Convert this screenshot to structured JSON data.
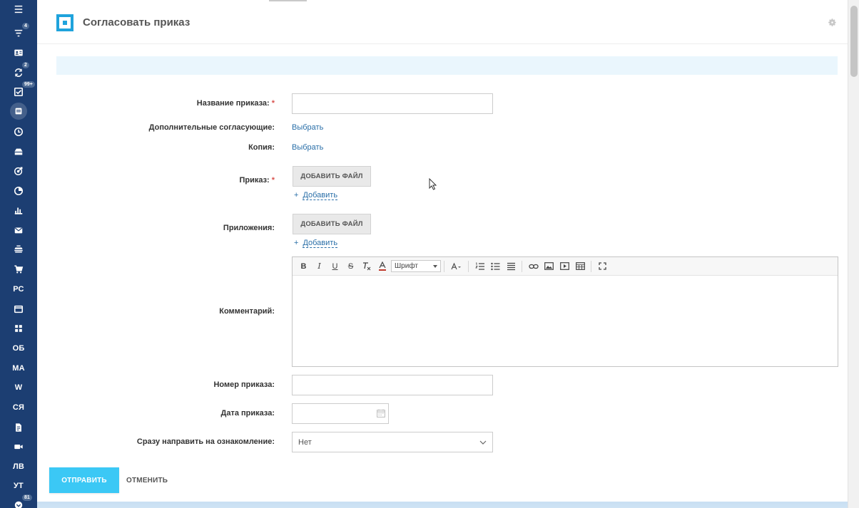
{
  "sidebar": {
    "items": [
      {
        "name": "menu-icon",
        "kind": "icon",
        "icon": "hamburger"
      },
      {
        "name": "filter-icon",
        "kind": "icon",
        "icon": "filter",
        "badge": "4"
      },
      {
        "name": "contact-card-icon",
        "kind": "icon",
        "icon": "card"
      },
      {
        "name": "sync-icon",
        "kind": "icon",
        "icon": "sync",
        "badge": "2"
      },
      {
        "name": "tasks-icon",
        "kind": "icon",
        "icon": "check",
        "badge": "99+"
      },
      {
        "name": "documents-icon",
        "kind": "icon",
        "icon": "doc-active"
      },
      {
        "name": "clock-icon",
        "kind": "icon",
        "icon": "clock"
      },
      {
        "name": "inbox-icon",
        "kind": "icon",
        "icon": "tray"
      },
      {
        "name": "target-icon",
        "kind": "icon",
        "icon": "target"
      },
      {
        "name": "pie-icon",
        "kind": "icon",
        "icon": "pie"
      },
      {
        "name": "bar-chart-icon",
        "kind": "icon",
        "icon": "bars"
      },
      {
        "name": "mail-icon",
        "kind": "icon",
        "icon": "mail"
      },
      {
        "name": "stack-icon",
        "kind": "icon",
        "icon": "stack"
      },
      {
        "name": "cart-icon",
        "kind": "icon",
        "icon": "cart"
      },
      {
        "name": "sidebar-item-pc",
        "kind": "text",
        "text": "РС"
      },
      {
        "name": "window-icon",
        "kind": "icon",
        "icon": "window"
      },
      {
        "name": "apps-icon",
        "kind": "icon",
        "icon": "grid"
      },
      {
        "name": "sidebar-item-ob",
        "kind": "text",
        "text": "ОБ"
      },
      {
        "name": "sidebar-item-ma",
        "kind": "text",
        "text": "МА"
      },
      {
        "name": "sidebar-item-w",
        "kind": "text",
        "text": "W"
      },
      {
        "name": "sidebar-item-sya",
        "kind": "text",
        "text": "СЯ"
      },
      {
        "name": "file-icon",
        "kind": "icon",
        "icon": "file"
      },
      {
        "name": "video-icon",
        "kind": "icon",
        "icon": "video"
      },
      {
        "name": "sidebar-item-lv",
        "kind": "text",
        "text": "ЛВ"
      },
      {
        "name": "sidebar-item-ut",
        "kind": "text",
        "text": "УТ"
      },
      {
        "name": "chevron-down-icon",
        "kind": "icon",
        "icon": "chev",
        "badge": "81"
      }
    ]
  },
  "header": {
    "title": "Согласовать приказ",
    "settings_icon": "gear-icon"
  },
  "form": {
    "order_name_label": "Название приказа:",
    "order_name_value": "",
    "extra_approvers_label": "Дополнительные согласующие:",
    "extra_approvers_link": "Выбрать",
    "copy_label": "Копия:",
    "copy_link": "Выбрать",
    "order_file_label": "Приказ:",
    "order_file_button": "ДОБАВИТЬ ФАЙЛ",
    "order_file_add": "Добавить",
    "attachments_label": "Приложения:",
    "attachments_button": "ДОБАВИТЬ ФАЙЛ",
    "attachments_add": "Добавить",
    "comment_label": "Комментарий:",
    "editor_font": "Шрифт",
    "order_number_label": "Номер приказа:",
    "order_number_value": "",
    "order_date_label": "Дата приказа:",
    "order_date_value": "",
    "send_label": "Сразу направить на ознакомление:",
    "send_value": "Нет",
    "required_mark": "*",
    "add_plus": "+"
  },
  "footer": {
    "submit": "ОТПРАВИТЬ",
    "cancel": "ОТМЕНИТЬ"
  },
  "colors": {
    "sidebar_bg": "#1c3e72",
    "accent": "#3bc8f5",
    "link": "#2a6fa8",
    "logo": "#1fa3dc"
  }
}
